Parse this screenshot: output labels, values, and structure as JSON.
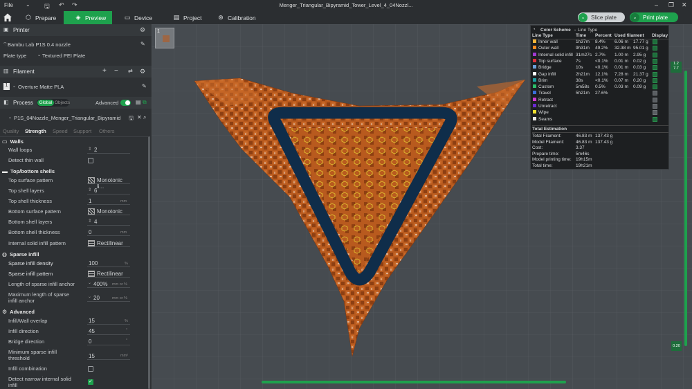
{
  "titlebar": {
    "file_label": "File",
    "title": "Menger_Triangular_Bipyramid_Tower_Level_4_04Nozzl..."
  },
  "nav": {
    "tabs": [
      {
        "label": "Prepare"
      },
      {
        "label": "Preview"
      },
      {
        "label": "Device"
      },
      {
        "label": "Project"
      },
      {
        "label": "Calibration"
      }
    ],
    "slice_label": "Slice plate",
    "print_label": "Print plate"
  },
  "printer": {
    "section": "Printer",
    "name": "Bambu Lab P1S 0.4 nozzle",
    "plate_type_label": "Plate type",
    "plate_type": "Textured PEI Plate"
  },
  "filament": {
    "section": "Filament",
    "index": "1",
    "name": "Overture Matte PLA"
  },
  "process": {
    "section": "Process",
    "global_label": "Global",
    "objects_label": "Objects",
    "advanced_label": "Advanced",
    "preset": "P1S_04Nozzle_Menger_Triangular_Bipyramid"
  },
  "subtabs": {
    "quality": "Quality",
    "strength": "Strength",
    "speed": "Speed",
    "support": "Support",
    "others": "Others"
  },
  "groups": {
    "walls": "Walls",
    "top_bottom": "Top/bottom shells",
    "sparse": "Sparse infill",
    "advanced": "Advanced"
  },
  "params": {
    "wall_loops": {
      "label": "Wall loops",
      "value": "2"
    },
    "detect_thin_wall": {
      "label": "Detect thin wall"
    },
    "top_surface_pattern": {
      "label": "Top surface pattern",
      "value": "Monotonic li..."
    },
    "top_shell_layers": {
      "label": "Top shell layers",
      "value": "6"
    },
    "top_shell_thickness": {
      "label": "Top shell thickness",
      "value": "1",
      "unit": "mm"
    },
    "bottom_surface_pattern": {
      "label": "Bottom surface pattern",
      "value": "Monotonic"
    },
    "bottom_shell_layers": {
      "label": "Bottom shell layers",
      "value": "4"
    },
    "bottom_shell_thickness": {
      "label": "Bottom shell thickness",
      "value": "0",
      "unit": "mm"
    },
    "internal_solid_infill": {
      "label": "Internal solid infill pattern",
      "value": "Rectilinear"
    },
    "sparse_density": {
      "label": "Sparse infill density",
      "value": "100",
      "unit": "%"
    },
    "sparse_pattern": {
      "label": "Sparse infill pattern",
      "value": "Rectilinear"
    },
    "anchor_len": {
      "label": "Length of sparse infill anchor",
      "value": "400%",
      "unit": "mm or %"
    },
    "anchor_max": {
      "label1": "Maximum length of sparse",
      "label2": "infill anchor",
      "value": "20",
      "unit": "mm or %"
    },
    "overlap": {
      "label": "Infill/Wall overlap",
      "value": "15",
      "unit": "%"
    },
    "infill_dir": {
      "label": "Infill direction",
      "value": "45",
      "unit": "°"
    },
    "bridge_dir": {
      "label": "Bridge direction",
      "value": "0",
      "unit": "°"
    },
    "min_sparse": {
      "label1": "Minimum sparse infill",
      "label2": "threshold",
      "value": "15",
      "unit": "mm²"
    },
    "infill_comb": {
      "label": "Infill combination"
    },
    "narrow": {
      "label1": "Detect narrow internal solid",
      "label2": "infill"
    }
  },
  "legend": {
    "title": "Color Scheme",
    "type": "Line Type",
    "headers": {
      "line_type": "Line Type",
      "time": "Time",
      "percent": "Percent",
      "used": "Used filament",
      "display": "Display"
    },
    "rows": [
      {
        "name": "Inner wall",
        "time": "1h37m",
        "pct": "8.4%",
        "len": "6.06 m",
        "g": "17.77 g",
        "color": "#f4b63a",
        "on": true
      },
      {
        "name": "Outer wall",
        "time": "9h31m",
        "pct": "49.2%",
        "len": "32.38 m",
        "g": "95.01 g",
        "color": "#ff8a1f",
        "on": true
      },
      {
        "name": "Internal solid infill",
        "time": "31m27s",
        "pct": "2.7%",
        "len": "1.00 m",
        "g": "2.95 g",
        "color": "#a03ad0",
        "on": true
      },
      {
        "name": "Top surface",
        "time": "7s",
        "pct": "<0.1%",
        "len": "0.01 m",
        "g": "0.02 g",
        "color": "#e0303a",
        "on": true
      },
      {
        "name": "Bridge",
        "time": "10s",
        "pct": "<0.1%",
        "len": "0.01 m",
        "g": "0.03 g",
        "color": "#6aa0d8",
        "on": true
      },
      {
        "name": "Gap infill",
        "time": "2h21m",
        "pct": "12.1%",
        "len": "7.28 m",
        "g": "21.37 g",
        "color": "#ffffff",
        "on": true
      },
      {
        "name": "Brim",
        "time": "38s",
        "pct": "<0.1%",
        "len": "0.07 m",
        "g": "0.20 g",
        "color": "#1a9da0",
        "on": true
      },
      {
        "name": "Custom",
        "time": "5m58s",
        "pct": "0.5%",
        "len": "0.03 m",
        "g": "0.09 g",
        "color": "#2bbf6a",
        "on": true
      },
      {
        "name": "Travel",
        "time": "5h21m",
        "pct": "27.6%",
        "len": "",
        "g": "",
        "color": "#3a6fd8",
        "on": false
      },
      {
        "name": "Retract",
        "time": "",
        "pct": "",
        "len": "",
        "g": "",
        "color": "#d23ad2",
        "on": false
      },
      {
        "name": "Unretract",
        "time": "",
        "pct": "",
        "len": "",
        "g": "",
        "color": "#6a2ad0",
        "on": false
      },
      {
        "name": "Wipe",
        "time": "",
        "pct": "",
        "len": "",
        "g": "",
        "color": "#f0e030",
        "on": false
      },
      {
        "name": "Seams",
        "time": "",
        "pct": "",
        "len": "",
        "g": "",
        "color": "#e8e8e8",
        "on": true
      }
    ],
    "total_title": "Total Estimation",
    "totals": [
      {
        "k": "Total Filament:",
        "a": "46.83 m",
        "b": "137.43 g"
      },
      {
        "k": "Model Filament:",
        "a": "46.83 m",
        "b": "137.43 g"
      },
      {
        "k": "Cost:",
        "a": "3.37",
        "b": ""
      },
      {
        "k": "Prepare time:",
        "a": "5m46s",
        "b": ""
      },
      {
        "k": "Model printing time:",
        "a": "19h15m",
        "b": ""
      },
      {
        "k": "Total time:",
        "a": "19h21m",
        "b": ""
      }
    ]
  },
  "viewport": {
    "plate_number": "1",
    "layer_top_a": "1.2",
    "layer_top_b": "7.7",
    "layer_bottom": "0.20",
    "model_color": "#b85a1e",
    "outline_color": "#0f2d4a"
  }
}
